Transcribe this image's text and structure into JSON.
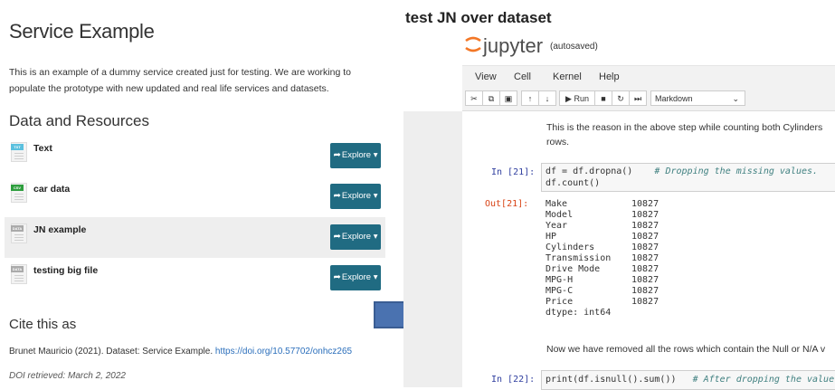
{
  "service": {
    "title": "Service Example",
    "description": "This is an example of a dummy service created just for testing. We are working to populate the prototype with new updated and real life services and datasets.",
    "resources_title": "Data and Resources",
    "resources": [
      {
        "label": "Text",
        "format": "TXT",
        "color": "#5bc0de",
        "explore": "Explore"
      },
      {
        "label": "car data",
        "format": "CSV",
        "color": "#2e9e3e",
        "explore": "Explore"
      },
      {
        "label": "JN example",
        "format": "DATA",
        "color": "#aaaaaa",
        "explore": "Explore",
        "highlighted": true
      },
      {
        "label": "testing big file",
        "format": "DATA",
        "color": "#aaaaaa",
        "explore": "Explore"
      }
    ],
    "cite_title": "Cite this as",
    "cite_text": "Brunet Mauricio (2021). Dataset: Service Example.",
    "cite_link": "https://doi.org/10.57702/onhcz265",
    "doi_retrieved": "DOI retrieved: March 2, 2022"
  },
  "notebook": {
    "heading": "test JN over dataset",
    "app_name": "jupyter",
    "autosaved": "(autosaved)",
    "menu": [
      "View",
      "Cell",
      "Kernel",
      "Help"
    ],
    "toolbar": {
      "run": "Run",
      "cell_type": "Markdown"
    },
    "md1": "This is the reason in the above step while counting both Cylinders",
    "md1b": "rows.",
    "in21": "In [21]:",
    "code21_a": "df = df.dropna()",
    "code21_comment": "# Dropping the missing values.",
    "code21_b": "df.count()",
    "out21": "Out[21]:",
    "outputs": [
      {
        "name": "Make",
        "value": "10827"
      },
      {
        "name": "Model",
        "value": "10827"
      },
      {
        "name": "Year",
        "value": "10827"
      },
      {
        "name": "HP",
        "value": "10827"
      },
      {
        "name": "Cylinders",
        "value": "10827"
      },
      {
        "name": "Transmission",
        "value": "10827"
      },
      {
        "name": "Drive Mode",
        "value": "10827"
      },
      {
        "name": "MPG-H",
        "value": "10827"
      },
      {
        "name": "MPG-C",
        "value": "10827"
      },
      {
        "name": "Price",
        "value": "10827"
      }
    ],
    "dtype": "dtype: int64",
    "md2": "Now we have removed all the rows which contain the Null or N/A v",
    "in22": "In [22]:",
    "code22": "print(df.isnull().sum())",
    "code22_comment": "# After dropping the value"
  }
}
